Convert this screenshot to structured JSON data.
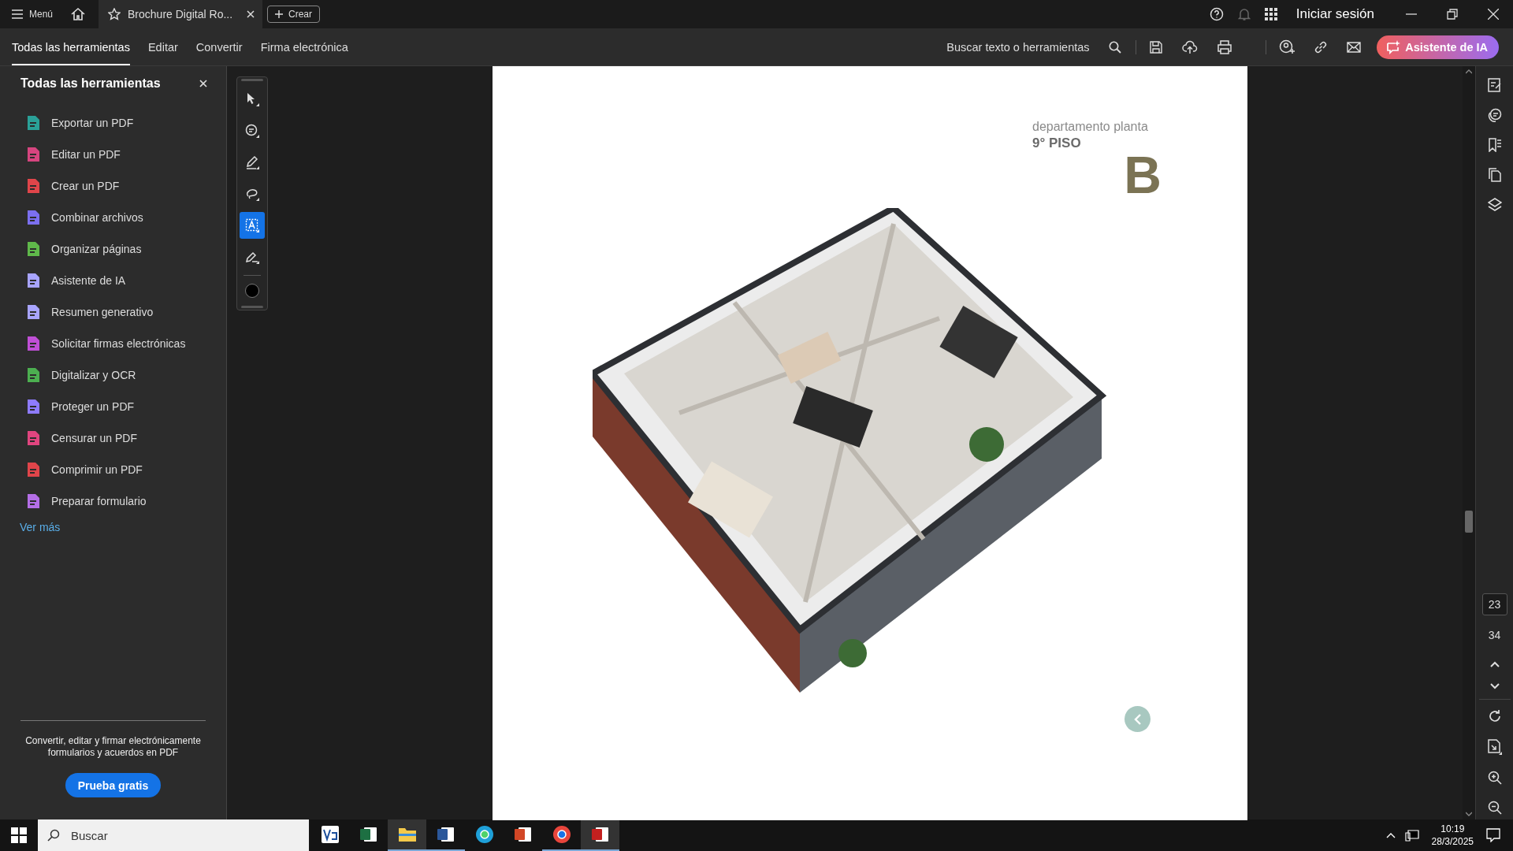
{
  "title_bar": {
    "menu_label": "Menú",
    "tab_title": "Brochure Digital Ro...",
    "new_button": "Crear",
    "sign_in": "Iniciar sesión"
  },
  "nav_tabs": [
    {
      "label": "Todas las herramientas",
      "selected": true
    },
    {
      "label": "Editar",
      "selected": false
    },
    {
      "label": "Convertir",
      "selected": false
    },
    {
      "label": "Firma electrónica",
      "selected": false
    }
  ],
  "search": {
    "placeholder": "Buscar texto o herramientas"
  },
  "ai_button": "Asistente de IA",
  "sidebar": {
    "title": "Todas las herramientas",
    "items": [
      {
        "label": "Exportar un PDF",
        "color": "#2aa198"
      },
      {
        "label": "Editar un PDF",
        "color": "#d6457f"
      },
      {
        "label": "Crear un PDF",
        "color": "#e0454a"
      },
      {
        "label": "Combinar archivos",
        "color": "#7b6ff0"
      },
      {
        "label": "Organizar páginas",
        "color": "#5fb84a"
      },
      {
        "label": "Asistente de IA",
        "color": "#a8a4ff"
      },
      {
        "label": "Resumen generativo",
        "color": "#a8a4ff"
      },
      {
        "label": "Solicitar firmas electrónicas",
        "color": "#c04fd6"
      },
      {
        "label": "Digitalizar y OCR",
        "color": "#4caf50"
      },
      {
        "label": "Proteger un PDF",
        "color": "#8e7bff"
      },
      {
        "label": "Censurar un PDF",
        "color": "#e0457f"
      },
      {
        "label": "Comprimir un PDF",
        "color": "#e0454a"
      },
      {
        "label": "Preparar formulario",
        "color": "#b46ee6"
      }
    ],
    "more_link": "Ver más",
    "promo_text": "Convertir, editar y firmar electrónicamente formularios y acuerdos en PDF",
    "promo_button": "Prueba gratis"
  },
  "drawing_tools": [
    {
      "selected": false
    },
    {
      "selected": false
    },
    {
      "selected": false
    },
    {
      "selected": false
    },
    {
      "selected": true
    },
    {
      "selected": false
    }
  ],
  "page": {
    "subtitle": "departamento planta",
    "floor": "9° PISO",
    "unit": "B"
  },
  "page_nav": {
    "current": "23",
    "total": "34"
  },
  "taskbar": {
    "search_placeholder": "Buscar",
    "apps": [
      {
        "kind": "remote",
        "active": false,
        "running": false
      },
      {
        "kind": "sheet",
        "active": false,
        "running": false
      },
      {
        "kind": "folder",
        "active": true,
        "running": true
      },
      {
        "kind": "doc",
        "active": false,
        "running": true
      },
      {
        "kind": "browser_e",
        "active": false,
        "running": false
      },
      {
        "kind": "slides",
        "active": false,
        "running": false
      },
      {
        "kind": "browser_c",
        "active": false,
        "running": true
      },
      {
        "kind": "pdf",
        "active": true,
        "running": true
      }
    ],
    "time": "10:19",
    "date": "28/3/2025"
  }
}
